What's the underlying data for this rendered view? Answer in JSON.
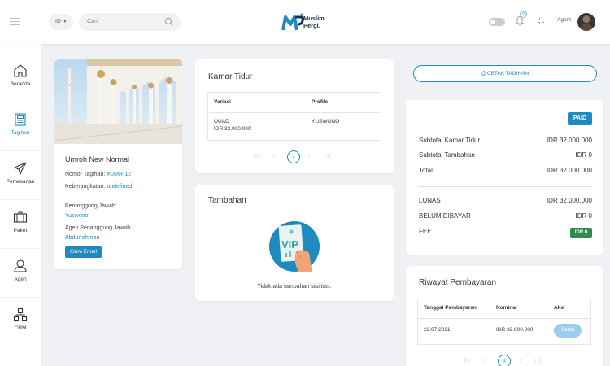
{
  "header": {
    "language": "ID",
    "search_placeholder": "Cari",
    "logo_line1": "Muslim",
    "logo_line2": "Pergi.",
    "notification_count": "0",
    "user_label": "Agent"
  },
  "sidebar": {
    "items": [
      {
        "label": "Beranda",
        "icon": "home-icon"
      },
      {
        "label": "Tagihan",
        "icon": "invoice-icon"
      },
      {
        "label": "Pemesanan",
        "icon": "plane-icon"
      },
      {
        "label": "Paket",
        "icon": "package-icon"
      },
      {
        "label": "Agen",
        "icon": "agent-icon"
      },
      {
        "label": "CRM",
        "icon": "crm-icon"
      }
    ]
  },
  "package": {
    "title": "Umroh New Normal",
    "invoice_label": "Nomor Tagihan: ",
    "invoice_value": "#UMR-12",
    "departure_label": "Keberangkatan: ",
    "departure_value": "undefined",
    "pic_label": "Penanggung Jawab:",
    "pic_value": "Yuswono",
    "agent_pic_label": "Agen Penanggung Jawab:",
    "agent_pic_value": "Abdurrahman",
    "email_button": "Kirim Email"
  },
  "rooms": {
    "title": "Kamar Tidur",
    "columns": [
      "Variasi",
      "Profile"
    ],
    "rows": [
      {
        "variant": "QUAD",
        "price": "IDR 32.000.000",
        "profile": "YUSWONO"
      }
    ],
    "pager": {
      "first": "|◁",
      "prev": "‹",
      "current": "1",
      "next": "›",
      "last": "▷|"
    }
  },
  "extras": {
    "title": "Tambahan",
    "empty_text": "Tidak ada tambahan fasilitas.",
    "vip_text": "VIP"
  },
  "summary": {
    "print_button": "CETAK TAGIHAN",
    "status": "PAID",
    "subtotal_room_label": "Subtotal Kamar Tidur",
    "subtotal_room_value": "IDR 32.000.000",
    "subtotal_extra_label": "Subtotal Tambahan",
    "subtotal_extra_value": "IDR 0",
    "total_label": "Total",
    "total_value": "IDR 32.000.000",
    "paid_label": "LUNAS",
    "paid_value": "IDR 32.000.000",
    "unpaid_label": "BELUM DIBAYAR",
    "unpaid_value": "IDR 0",
    "fee_label": "FEE",
    "fee_value": "IDR 0"
  },
  "payments": {
    "title": "Riwayat Pembayaran",
    "columns": [
      "Tanggal Pembayaran",
      "Nominal",
      "Aksi"
    ],
    "rows": [
      {
        "date": "22.07.2021",
        "amount": "IDR 32.000.000",
        "action": "Detail"
      }
    ],
    "pager": {
      "first": "|◁",
      "prev": "‹",
      "current": "1",
      "next": "›",
      "last": "▷|"
    }
  },
  "colors": {
    "primary": "#1f8ac0",
    "success": "#2e8b4a",
    "background": "#f0f1f4"
  }
}
